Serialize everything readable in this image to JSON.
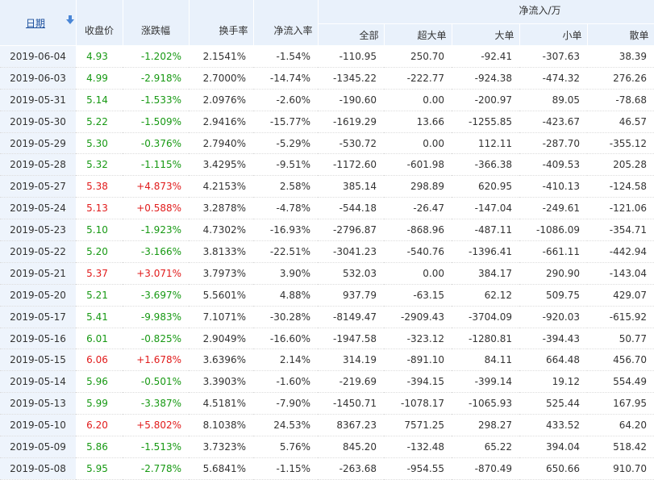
{
  "header": {
    "date": "日期",
    "close": "收盘价",
    "change_pct": "涨跌幅",
    "turnover": "换手率",
    "net_rate": "净流入率",
    "net_group": "净流入/万",
    "sub": [
      "全部",
      "超大单",
      "大单",
      "小单",
      "散单"
    ]
  },
  "colors": {
    "up": "#e11b1b",
    "down": "#179913",
    "header_bg": "#e9f1fb",
    "date_bg": "#eef4fc",
    "link": "#1a4e9c"
  },
  "rows": [
    {
      "date": "2019-06-04",
      "close": "4.93",
      "change": "-1.202%",
      "turnover": "2.1541%",
      "rate": "-1.54%",
      "all": "-110.95",
      "xl": "250.70",
      "l": "-92.41",
      "s": "-307.63",
      "r": "38.39",
      "trend": "down"
    },
    {
      "date": "2019-06-03",
      "close": "4.99",
      "change": "-2.918%",
      "turnover": "2.7000%",
      "rate": "-14.74%",
      "all": "-1345.22",
      "xl": "-222.77",
      "l": "-924.38",
      "s": "-474.32",
      "r": "276.26",
      "trend": "down"
    },
    {
      "date": "2019-05-31",
      "close": "5.14",
      "change": "-1.533%",
      "turnover": "2.0976%",
      "rate": "-2.60%",
      "all": "-190.60",
      "xl": "0.00",
      "l": "-200.97",
      "s": "89.05",
      "r": "-78.68",
      "trend": "down"
    },
    {
      "date": "2019-05-30",
      "close": "5.22",
      "change": "-1.509%",
      "turnover": "2.9416%",
      "rate": "-15.77%",
      "all": "-1619.29",
      "xl": "13.66",
      "l": "-1255.85",
      "s": "-423.67",
      "r": "46.57",
      "trend": "down"
    },
    {
      "date": "2019-05-29",
      "close": "5.30",
      "change": "-0.376%",
      "turnover": "2.7940%",
      "rate": "-5.29%",
      "all": "-530.72",
      "xl": "0.00",
      "l": "112.11",
      "s": "-287.70",
      "r": "-355.12",
      "trend": "down"
    },
    {
      "date": "2019-05-28",
      "close": "5.32",
      "change": "-1.115%",
      "turnover": "3.4295%",
      "rate": "-9.51%",
      "all": "-1172.60",
      "xl": "-601.98",
      "l": "-366.38",
      "s": "-409.53",
      "r": "205.28",
      "trend": "down"
    },
    {
      "date": "2019-05-27",
      "close": "5.38",
      "change": "+4.873%",
      "turnover": "4.2153%",
      "rate": "2.58%",
      "all": "385.14",
      "xl": "298.89",
      "l": "620.95",
      "s": "-410.13",
      "r": "-124.58",
      "trend": "up"
    },
    {
      "date": "2019-05-24",
      "close": "5.13",
      "change": "+0.588%",
      "turnover": "3.2878%",
      "rate": "-4.78%",
      "all": "-544.18",
      "xl": "-26.47",
      "l": "-147.04",
      "s": "-249.61",
      "r": "-121.06",
      "trend": "up"
    },
    {
      "date": "2019-05-23",
      "close": "5.10",
      "change": "-1.923%",
      "turnover": "4.7302%",
      "rate": "-16.93%",
      "all": "-2796.87",
      "xl": "-868.96",
      "l": "-487.11",
      "s": "-1086.09",
      "r": "-354.71",
      "trend": "down"
    },
    {
      "date": "2019-05-22",
      "close": "5.20",
      "change": "-3.166%",
      "turnover": "3.8133%",
      "rate": "-22.51%",
      "all": "-3041.23",
      "xl": "-540.76",
      "l": "-1396.41",
      "s": "-661.11",
      "r": "-442.94",
      "trend": "down"
    },
    {
      "date": "2019-05-21",
      "close": "5.37",
      "change": "+3.071%",
      "turnover": "3.7973%",
      "rate": "3.90%",
      "all": "532.03",
      "xl": "0.00",
      "l": "384.17",
      "s": "290.90",
      "r": "-143.04",
      "trend": "up"
    },
    {
      "date": "2019-05-20",
      "close": "5.21",
      "change": "-3.697%",
      "turnover": "5.5601%",
      "rate": "4.88%",
      "all": "937.79",
      "xl": "-63.15",
      "l": "62.12",
      "s": "509.75",
      "r": "429.07",
      "trend": "down"
    },
    {
      "date": "2019-05-17",
      "close": "5.41",
      "change": "-9.983%",
      "turnover": "7.1071%",
      "rate": "-30.28%",
      "all": "-8149.47",
      "xl": "-2909.43",
      "l": "-3704.09",
      "s": "-920.03",
      "r": "-615.92",
      "trend": "down"
    },
    {
      "date": "2019-05-16",
      "close": "6.01",
      "change": "-0.825%",
      "turnover": "2.9049%",
      "rate": "-16.60%",
      "all": "-1947.58",
      "xl": "-323.12",
      "l": "-1280.81",
      "s": "-394.43",
      "r": "50.77",
      "trend": "down"
    },
    {
      "date": "2019-05-15",
      "close": "6.06",
      "change": "+1.678%",
      "turnover": "3.6396%",
      "rate": "2.14%",
      "all": "314.19",
      "xl": "-891.10",
      "l": "84.11",
      "s": "664.48",
      "r": "456.70",
      "trend": "up"
    },
    {
      "date": "2019-05-14",
      "close": "5.96",
      "change": "-0.501%",
      "turnover": "3.3903%",
      "rate": "-1.60%",
      "all": "-219.69",
      "xl": "-394.15",
      "l": "-399.14",
      "s": "19.12",
      "r": "554.49",
      "trend": "down"
    },
    {
      "date": "2019-05-13",
      "close": "5.99",
      "change": "-3.387%",
      "turnover": "4.5181%",
      "rate": "-7.90%",
      "all": "-1450.71",
      "xl": "-1078.17",
      "l": "-1065.93",
      "s": "525.44",
      "r": "167.95",
      "trend": "down"
    },
    {
      "date": "2019-05-10",
      "close": "6.20",
      "change": "+5.802%",
      "turnover": "8.1038%",
      "rate": "24.53%",
      "all": "8367.23",
      "xl": "7571.25",
      "l": "298.27",
      "s": "433.52",
      "r": "64.20",
      "trend": "up"
    },
    {
      "date": "2019-05-09",
      "close": "5.86",
      "change": "-1.513%",
      "turnover": "3.7323%",
      "rate": "5.76%",
      "all": "845.20",
      "xl": "-132.48",
      "l": "65.22",
      "s": "394.04",
      "r": "518.42",
      "trend": "down"
    },
    {
      "date": "2019-05-08",
      "close": "5.95",
      "change": "-2.778%",
      "turnover": "5.6841%",
      "rate": "-1.15%",
      "all": "-263.68",
      "xl": "-954.55",
      "l": "-870.49",
      "s": "650.66",
      "r": "910.70",
      "trend": "down"
    }
  ]
}
